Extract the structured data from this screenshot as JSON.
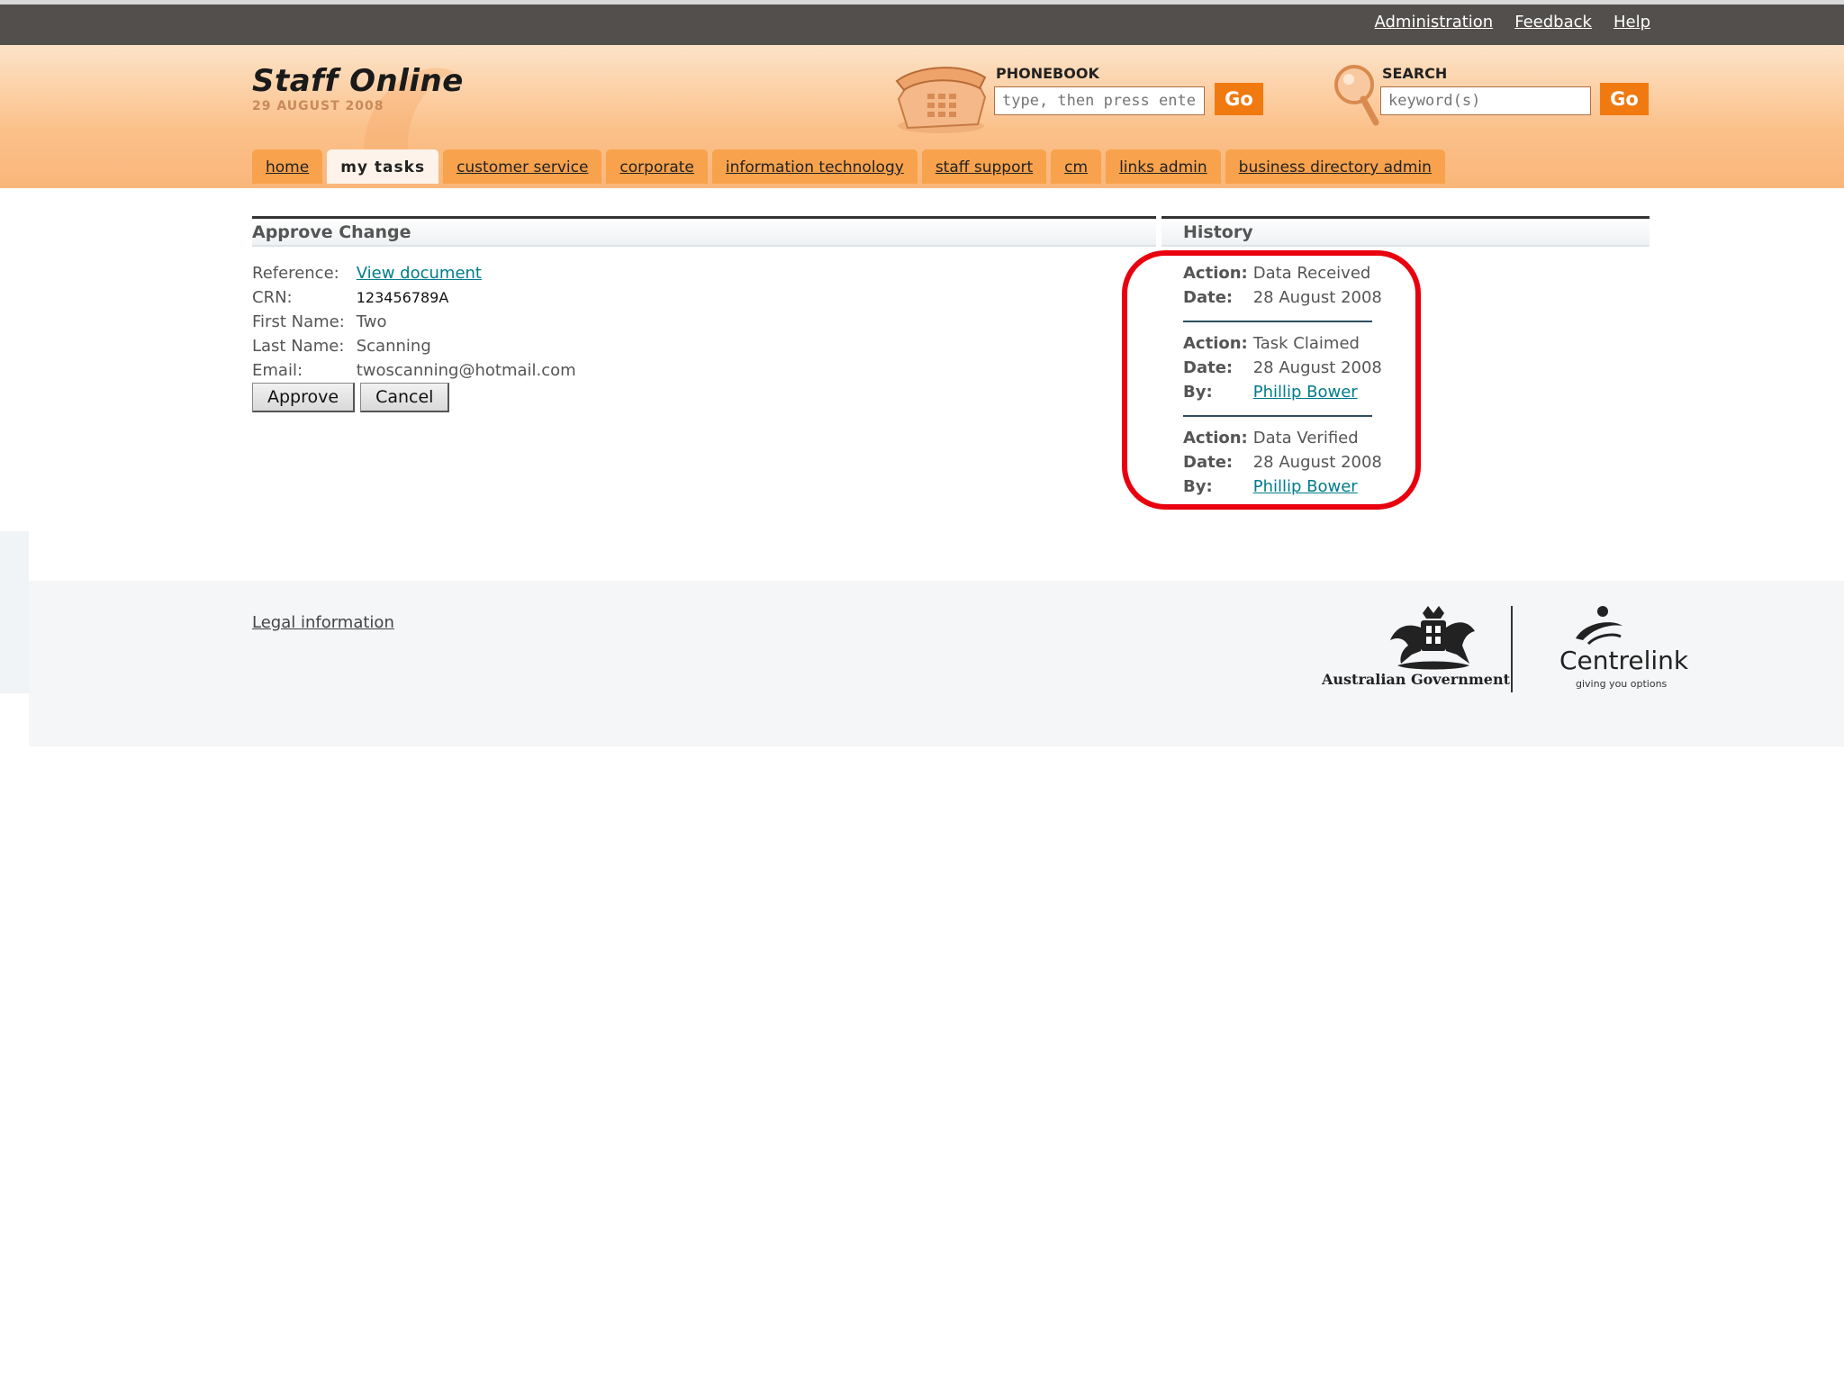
{
  "topbar": {
    "links": [
      "Administration",
      "Feedback",
      "Help"
    ]
  },
  "header": {
    "title": "Staff Online",
    "date": "29 AUGUST 2008",
    "phonebook": {
      "label": "PHONEBOOK",
      "placeholder": "type, then press enter",
      "go_label": "Go"
    },
    "search": {
      "label": "SEARCH",
      "placeholder": "keyword(s)",
      "go_label": "Go"
    }
  },
  "tabs": [
    {
      "label": "home"
    },
    {
      "label": "my tasks",
      "active": true
    },
    {
      "label": "customer service"
    },
    {
      "label": "corporate"
    },
    {
      "label": "information technology"
    },
    {
      "label": "staff support"
    },
    {
      "label": "cm"
    },
    {
      "label": "links admin"
    },
    {
      "label": "business directory admin"
    }
  ],
  "approve_change": {
    "heading": "Approve Change",
    "fields": {
      "reference": {
        "label": "Reference:",
        "value": "View document"
      },
      "crn": {
        "label": "CRN:",
        "value": "123456789A"
      },
      "first_name": {
        "label": "First Name:",
        "value": "Two"
      },
      "last_name": {
        "label": "Last Name:",
        "value": "Scanning"
      },
      "email": {
        "label": "Email:",
        "value": "twoscanning@hotmail.com"
      }
    },
    "buttons": {
      "approve": "Approve",
      "cancel": "Cancel"
    }
  },
  "history": {
    "heading": "History",
    "labels": {
      "action": "Action:",
      "date": "Date:",
      "by": "By:"
    },
    "entries": [
      {
        "action": "Data Received",
        "date": "28 August 2008"
      },
      {
        "action": "Task Claimed",
        "date": "28 August 2008",
        "by": "Phillip Bower"
      },
      {
        "action": "Data Verified",
        "date": "28 August 2008",
        "by": "Phillip Bower"
      }
    ]
  },
  "footer": {
    "legal_link": "Legal information",
    "gov_logo_text": "Australian Government",
    "centrelink_name": "Centrelink",
    "centrelink_tagline": "giving you options"
  },
  "colors": {
    "topbar": "#524f4d",
    "header_orange": "#fbc089",
    "tab_orange": "#f8a24d",
    "go_button": "#f07a10",
    "link_teal": "#007b8a",
    "highlight_red": "#e8000f"
  }
}
